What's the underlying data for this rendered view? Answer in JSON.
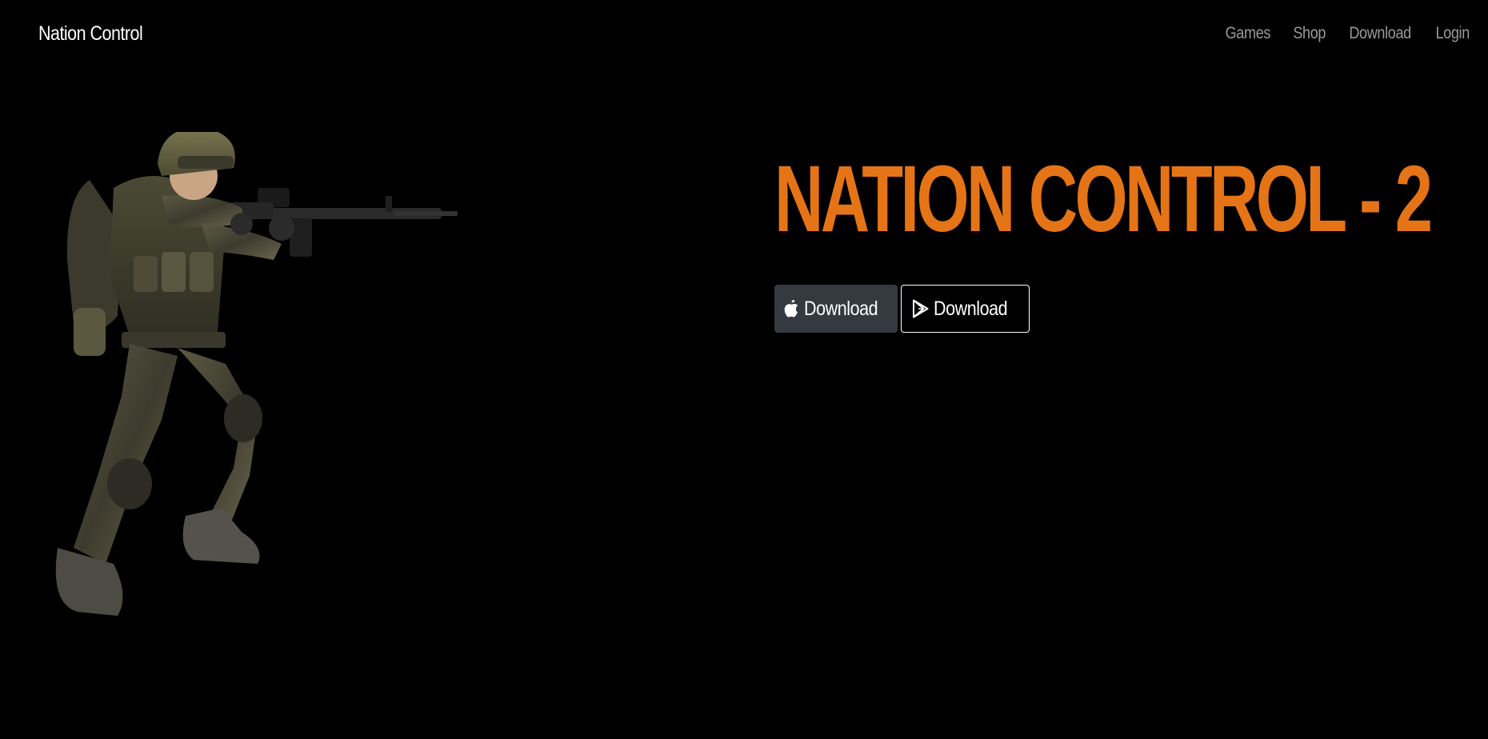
{
  "navbar": {
    "brand": "Nation Control",
    "links": [
      "Games",
      "Shop",
      "Download",
      "Login"
    ]
  },
  "hero": {
    "title": "NATION CONTROL - 2",
    "buttons": [
      {
        "label": "Download",
        "icon": "apple-icon"
      },
      {
        "label": "Download",
        "icon": "google-play-icon"
      }
    ],
    "image": "soldier-with-rifle"
  },
  "colors": {
    "background": "#000000",
    "title": "#e57417",
    "dark_button": "#343a40",
    "nav_link": "#9a9a9a"
  }
}
